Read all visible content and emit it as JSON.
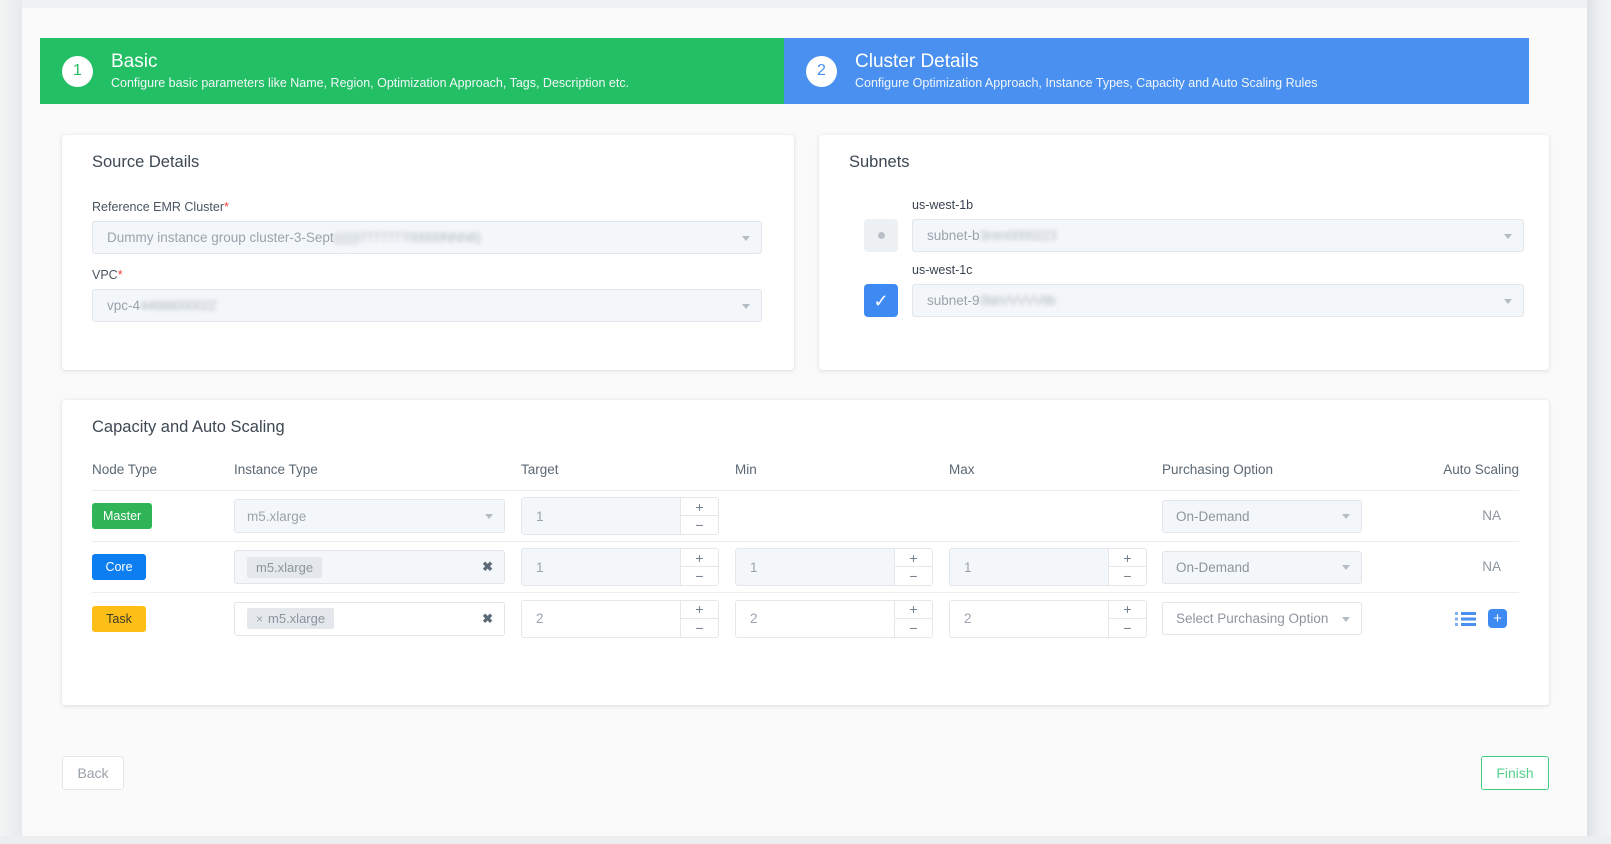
{
  "stepper": {
    "steps": [
      {
        "number": "1",
        "title": "Basic",
        "subtitle": "Configure basic parameters like Name, Region, Optimization Approach, Tags, Description etc.",
        "color": "#22bf65",
        "state": "completed"
      },
      {
        "number": "2",
        "title": "Cluster Details",
        "subtitle": "Configure Optimization Approach, Instance Types, Capacity and Auto Scaling Rules",
        "color": "#4a90f0",
        "state": "active"
      }
    ]
  },
  "source_details": {
    "title": "Source Details",
    "emr_cluster": {
      "label": "Reference EMR Cluster",
      "required_mark": "*",
      "value_visible": "Dummy instance group cluster-3-Sept",
      "value_redacted": "((((((i777777700000NNN6)"
    },
    "vpc": {
      "label": "VPC",
      "required_mark": "*",
      "value_visible": "vpc-4",
      "value_redacted": "4466600002Z"
    }
  },
  "subnets": {
    "title": "Subnets",
    "rows": [
      {
        "az": "us-west-1b",
        "selected": false,
        "toggle_icon": "radio-dot-icon",
        "value_visible": "subnet-b",
        "value_redacted": "3mm0000223"
      },
      {
        "az": "us-west-1c",
        "selected": true,
        "toggle_icon": "check-icon",
        "value_visible": "subnet-9",
        "value_redacted": "0bbVVVVVIIb"
      }
    ]
  },
  "capacity": {
    "title": "Capacity and Auto Scaling",
    "columns": [
      "Node Type",
      "Instance Type",
      "Target",
      "Min",
      "Max",
      "Purchasing Option",
      "Auto Scaling"
    ],
    "rows": [
      {
        "node_type": "Master",
        "node_color": "#2fb457",
        "instance_type": "m5.xlarge",
        "instance_is_chip": false,
        "instance_chip_prefix": "",
        "instance_clearable": false,
        "instance_disabled": true,
        "target": "1",
        "target_disabled": true,
        "min": "",
        "max": "",
        "has_min": false,
        "has_max": false,
        "purchasing_option": "On-Demand",
        "purchasing_disabled": true,
        "auto_scaling": "NA",
        "auto_scaling_icons": false
      },
      {
        "node_type": "Core",
        "node_color": "#0d7df2",
        "instance_type": "m5.xlarge",
        "instance_is_chip": true,
        "instance_chip_prefix": "",
        "instance_clearable": true,
        "instance_disabled": true,
        "target": "1",
        "target_disabled": true,
        "min": "1",
        "max": "1",
        "has_min": true,
        "has_max": true,
        "purchasing_option": "On-Demand",
        "purchasing_disabled": true,
        "auto_scaling": "NA",
        "auto_scaling_icons": false
      },
      {
        "node_type": "Task",
        "node_color": "#fcbe17",
        "instance_type": "m5.xlarge",
        "instance_is_chip": true,
        "instance_chip_prefix": "×",
        "instance_clearable": true,
        "instance_disabled": false,
        "target": "2",
        "target_disabled": false,
        "min": "2",
        "max": "2",
        "has_min": true,
        "has_max": true,
        "purchasing_option": "Select Purchasing Option",
        "purchasing_disabled": false,
        "auto_scaling": "",
        "auto_scaling_icons": true,
        "auto_scaling_icon_names": [
          "list-icon",
          "add-icon"
        ]
      }
    ],
    "stepper_plus": "+",
    "stepper_minus": "−",
    "clear_glyph": "✖"
  },
  "footer": {
    "back_label": "Back",
    "finish_label": "Finish",
    "finish_color": "#3fcc7c"
  }
}
